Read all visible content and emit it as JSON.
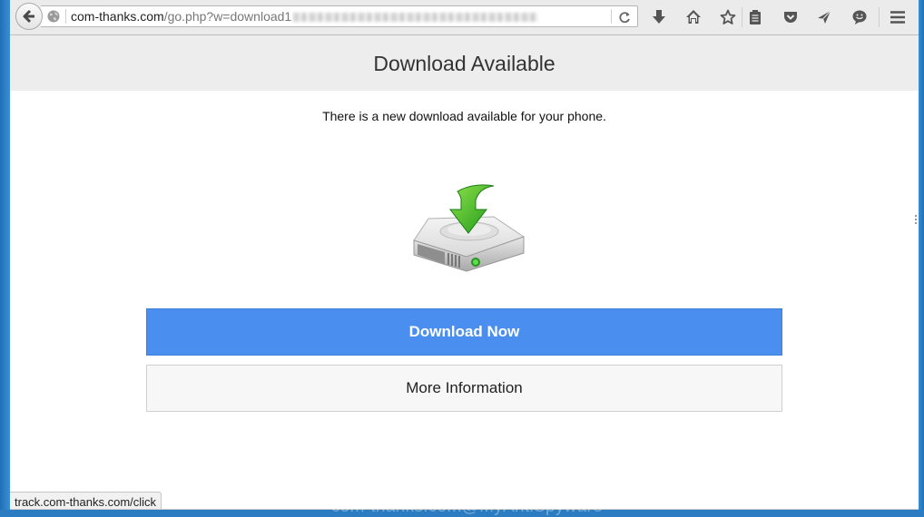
{
  "browser": {
    "url_host": "com-thanks.com",
    "url_path": "/go.php?w=download1",
    "url_obscured": true,
    "toolbar_icons": [
      "download-icon",
      "home-icon",
      "bookmark-star-icon",
      "reading-list-icon",
      "pocket-icon",
      "send-icon",
      "chat-icon",
      "menu-icon"
    ]
  },
  "page": {
    "title": "Download Available",
    "subtitle": "There is a new download available for your phone.",
    "hero_icon": "hard-drive-download-icon",
    "primary_button": "Download Now",
    "secondary_button": "More Information"
  },
  "status": {
    "link_preview": "track.com-thanks.com/click"
  },
  "watermark": "com-thanks.com@MyAntiSpyware",
  "colors": {
    "primary_button": "#4a8ff0",
    "header_band": "#ededed",
    "desktop": "#2a7fc4"
  }
}
